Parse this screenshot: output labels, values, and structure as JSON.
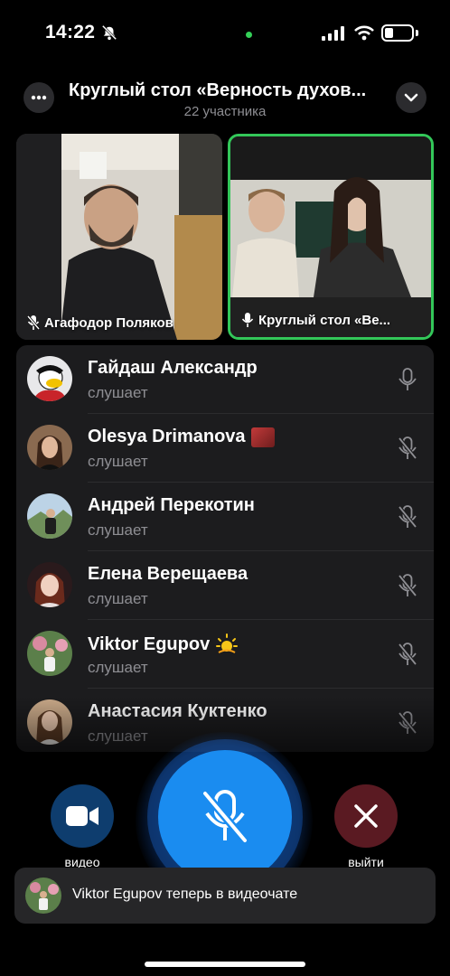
{
  "status_bar": {
    "time": "14:22"
  },
  "header": {
    "title": "Круглый стол «Верность духов...",
    "subtitle": "22 участника"
  },
  "video_tiles": [
    {
      "label": "Агафодор Поляков",
      "active": false
    },
    {
      "label": "Круглый стол «Ве...",
      "active": true
    }
  ],
  "participants": [
    {
      "name": "Гайдаш Александр",
      "status": "слушает",
      "mic": "on"
    },
    {
      "name": "Olesya Drimanova",
      "status": "слушает",
      "mic": "muted",
      "badge": "flag-emoji"
    },
    {
      "name": "Андрей Перекотин",
      "status": "слушает",
      "mic": "muted"
    },
    {
      "name": "Елена Верещаева",
      "status": "слушает",
      "mic": "muted"
    },
    {
      "name": "Viktor Egupov",
      "status": "слушает",
      "mic": "muted",
      "badge": "sun-emoji"
    },
    {
      "name": "Анастасия Куктенко",
      "status": "слушает",
      "mic": "muted"
    }
  ],
  "controls": {
    "video_label": "видео",
    "leave_label": "выйти"
  },
  "toast": {
    "text": "Viktor Egupov теперь в видеочате"
  },
  "colors": {
    "accent_blue": "#1a8cf0",
    "speaking_green": "#33c759",
    "leave_red": "#5a1a22",
    "panel": "#1c1c1e",
    "secondary_text": "#8e8e93"
  }
}
